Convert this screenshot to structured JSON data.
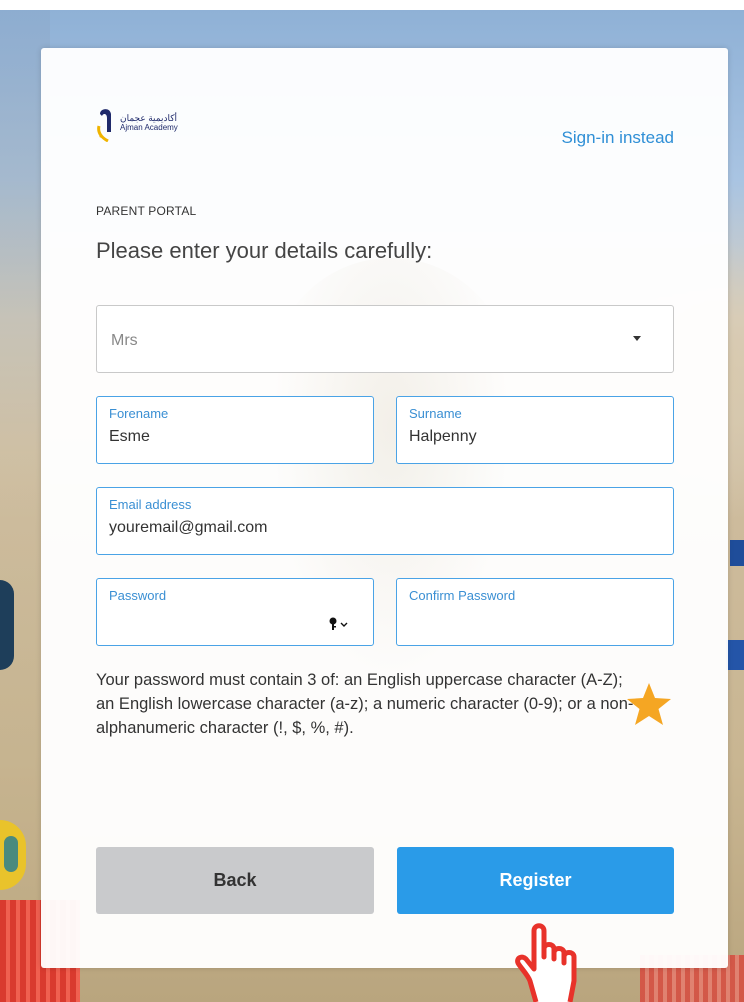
{
  "brand": {
    "name_en": "Ajman Academy",
    "name_ar": "أكاديمية عجمان"
  },
  "header": {
    "signin_link": "Sign-in instead",
    "portal_label": "PARENT PORTAL",
    "heading": "Please enter your details carefully:"
  },
  "form": {
    "title_select": {
      "value": "Mrs"
    },
    "forename": {
      "label": "Forename",
      "value": "Esme"
    },
    "surname": {
      "label": "Surname",
      "value": "Halpenny"
    },
    "email": {
      "label": "Email address",
      "value": "youremail@gmail.com"
    },
    "password": {
      "label": "Password",
      "value": ""
    },
    "confirm_password": {
      "label": "Confirm Password",
      "value": ""
    },
    "hint": "Your password must contain 3 of: an English uppercase character (A-Z); an English lowercase character (a-z); a numeric character (0-9); or a non-alphanumeric character (!, $, %, #)."
  },
  "buttons": {
    "back": "Back",
    "register": "Register"
  },
  "colors": {
    "accent": "#2a9be8",
    "link": "#2f8fd6",
    "field_border": "#4aa3e6",
    "star": "#f5a623",
    "hand": "#e8322a"
  },
  "icons": [
    "password-key-icon",
    "dropdown-caret-icon",
    "star-icon",
    "pointing-hand-icon"
  ]
}
